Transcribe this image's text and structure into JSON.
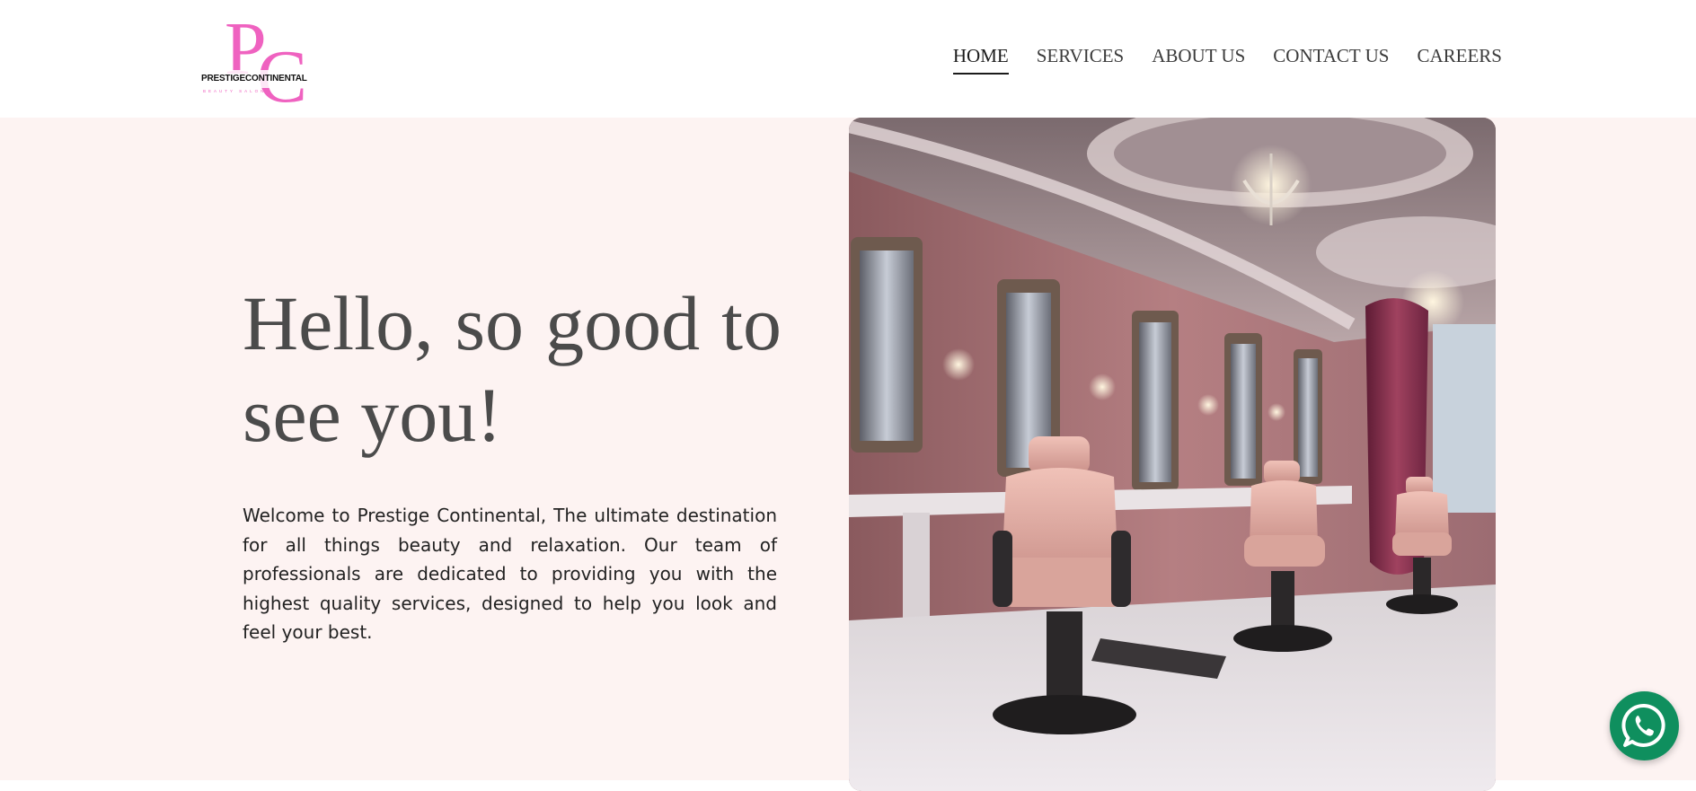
{
  "brand": {
    "name": "PRESTIGECONTINENTAL",
    "tagline": "BEAUTY SALON",
    "monogram": "PC",
    "color": "#ef62c0"
  },
  "nav": {
    "items": [
      {
        "label": "HOME",
        "active": true
      },
      {
        "label": "SERVICES",
        "active": false
      },
      {
        "label": "ABOUT US",
        "active": false
      },
      {
        "label": "CONTACT US",
        "active": false
      },
      {
        "label": "CAREERS",
        "active": false
      }
    ]
  },
  "hero": {
    "headline": "Hello, so good to see you!",
    "intro": "Welcome to Prestige Continental, The ultimate destination for all things beauty and relaxation. Our team of professionals are dedicated to providing you with the highest quality services, designed to help you look and feel your best.",
    "image_subject": "luxury pink salon interior with styling chairs, mirrors and chandeliers"
  },
  "colors": {
    "hero_background": "#fdf3f2",
    "text_dark": "#4b4b4b",
    "whatsapp_green": "#0f8f5e"
  },
  "icons": {
    "chat": "whatsapp-icon"
  }
}
